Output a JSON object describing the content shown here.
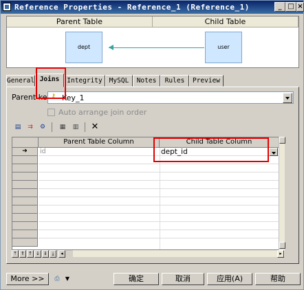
{
  "window": {
    "title": "Reference Properties - Reference_1 (Reference_1)",
    "controls": {
      "minimize": "_",
      "maximize": "□",
      "close": "×"
    }
  },
  "diagram": {
    "parent_header": "Parent Table",
    "child_header": "Child Table",
    "parent_entity": "dept",
    "child_entity": "user"
  },
  "tabs": [
    {
      "label": "General"
    },
    {
      "label": "Joins",
      "active": true
    },
    {
      "label": "Integrity"
    },
    {
      "label": "MySQL"
    },
    {
      "label": "Notes"
    },
    {
      "label": "Rules"
    },
    {
      "label": "Preview"
    }
  ],
  "joins": {
    "parent_key_label": "Parent key:",
    "parent_key_value": "Key_1",
    "auto_arrange_label": "Auto arrange join order",
    "auto_arrange_checked": false,
    "toolbar_icons": [
      "properties-icon",
      "add-row-icon",
      "reuse-columns-icon",
      "insert-row-icon",
      "add-columns-icon",
      "delete-icon"
    ],
    "grid": {
      "columns": [
        "Parent Table Column",
        "Child Table Column"
      ],
      "rows": [
        {
          "parent": "id",
          "child": "dept_id"
        }
      ]
    }
  },
  "footer": {
    "more": "More >>",
    "ok": "确定",
    "cancel": "取消",
    "apply": "应用(A)",
    "help": "帮助"
  }
}
